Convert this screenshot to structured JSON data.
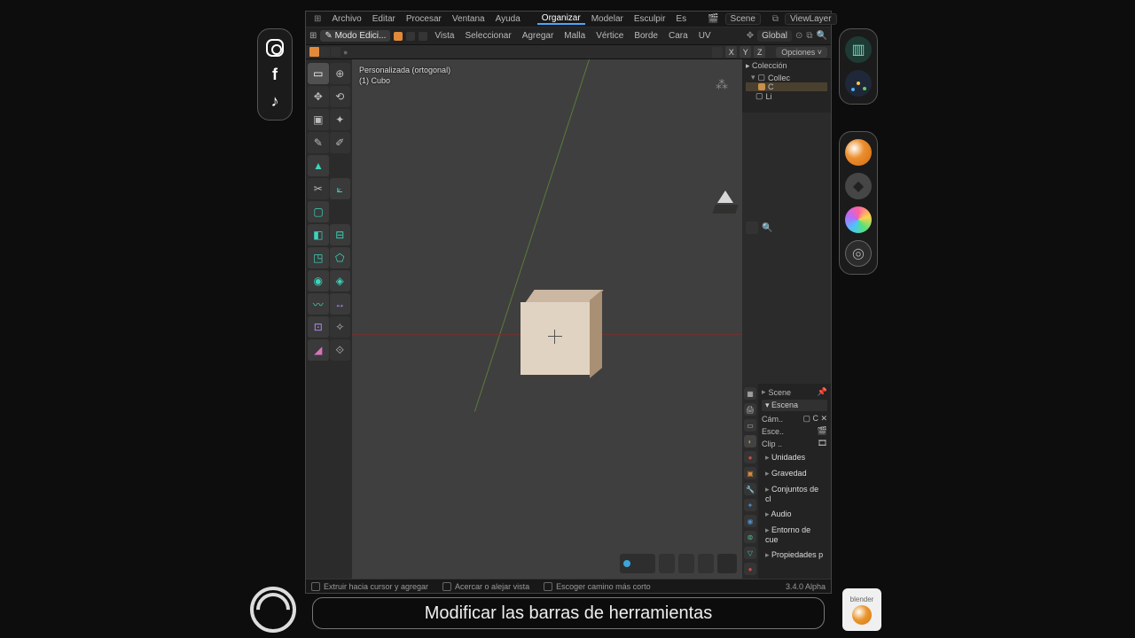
{
  "menubar": {
    "items": [
      "Archivo",
      "Editar",
      "Procesar",
      "Ventana",
      "Ayuda"
    ],
    "workspaces": [
      "Organizar",
      "Modelar",
      "Esculpir",
      "Es"
    ],
    "scene": "Scene",
    "viewlayer": "ViewLayer"
  },
  "toolbar2": {
    "mode": "Modo Edici...",
    "menus": [
      "Vista",
      "Seleccionar",
      "Agregar",
      "Malla",
      "Vértice",
      "Borde",
      "Cara",
      "UV"
    ],
    "orient": "Global"
  },
  "header3": {
    "axes": [
      "X",
      "Y",
      "Z"
    ],
    "options": "Opciones"
  },
  "viewport": {
    "proj": "Personalizada (ortogonal)",
    "obj": "(1) Cubo"
  },
  "outliner": {
    "header": "Colección",
    "items": [
      "Collec",
      "C",
      "Li"
    ]
  },
  "properties": {
    "context": "Scene",
    "panel": "Escena",
    "rows": [
      "Cám..",
      "Esce..",
      "Clip .."
    ],
    "sections": [
      "Unidades",
      "Gravedad",
      "Conjuntos de cl",
      "Audio",
      "Entorno de cue",
      "Propiedades p"
    ]
  },
  "status": {
    "a": "Extruir hacia cursor y agregar",
    "b": "Acercar o alejar vista",
    "c": "Escoger camino más corto",
    "ver": "3.4.0 Alpha"
  },
  "caption": "Modificar las barras de herramientas",
  "badge": "blender"
}
